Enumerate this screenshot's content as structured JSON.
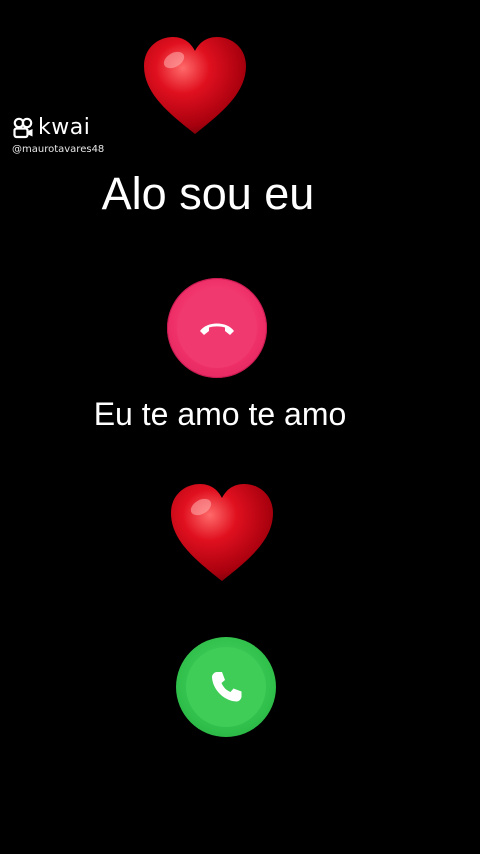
{
  "watermark": {
    "brand": "kwai",
    "handle": "@maurotavares48"
  },
  "lyrics": {
    "line_1": "Alo sou eu",
    "line_2": "Eu te amo te amo"
  },
  "call": {
    "decline_icon": "phone-hangup-icon",
    "accept_icon": "phone-icon"
  },
  "colors": {
    "background": "#000000",
    "heart": "#d6001c",
    "decline": "#ee2f68",
    "accept": "#3fcd58"
  }
}
